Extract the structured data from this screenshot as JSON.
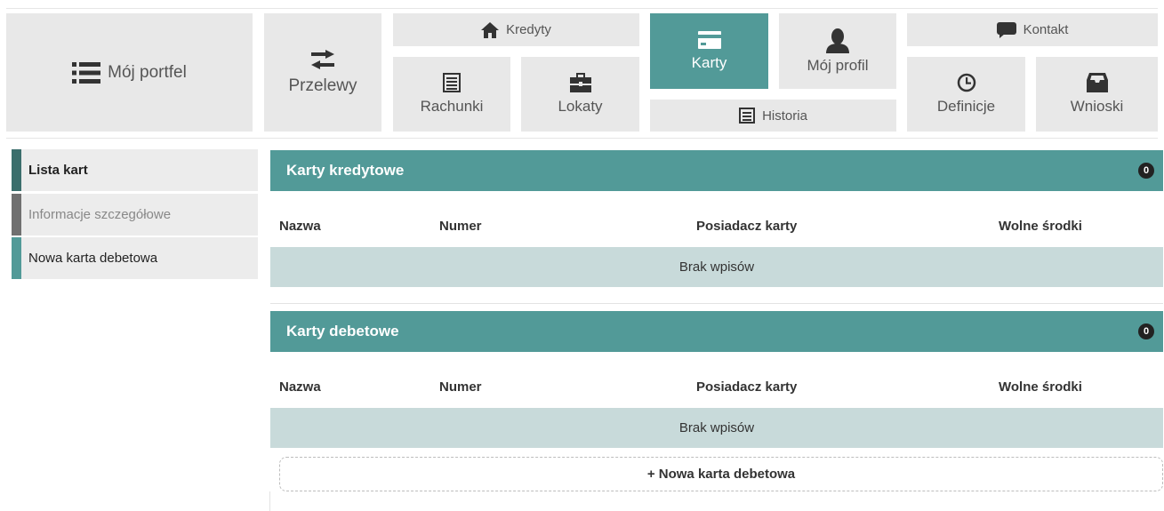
{
  "nav": {
    "portfolio": "Mój portfel",
    "transfers": "Przelewy",
    "credits": "Kredyty",
    "accounts": "Rachunki",
    "deposits": "Lokaty",
    "cards": "Karty",
    "history": "Historia",
    "profile": "Mój profil",
    "contact": "Kontakt",
    "definitions": "Definicje",
    "applications": "Wnioski"
  },
  "sidebar": {
    "items": [
      {
        "label": "Lista kart",
        "accent": "#3b6e6c"
      },
      {
        "label": "Informacje szczegółowe",
        "accent": "#707070"
      },
      {
        "label": "Nowa karta debetowa",
        "accent": "#529a98"
      }
    ]
  },
  "panels": [
    {
      "title": "Karty kredytowe",
      "count": "0",
      "columns": [
        "Nazwa",
        "Numer",
        "Posiadacz karty",
        "Wolne środki"
      ],
      "empty": "Brak wpisów"
    },
    {
      "title": "Karty debetowe",
      "count": "0",
      "columns": [
        "Nazwa",
        "Numer",
        "Posiadacz karty",
        "Wolne środki"
      ],
      "empty": "Brak wpisów",
      "add_label": "+ Nowa karta debetowa"
    }
  ],
  "colors": {
    "accent": "#529a98",
    "tile": "#e8e8e8",
    "empty_row": "#c8dada"
  }
}
